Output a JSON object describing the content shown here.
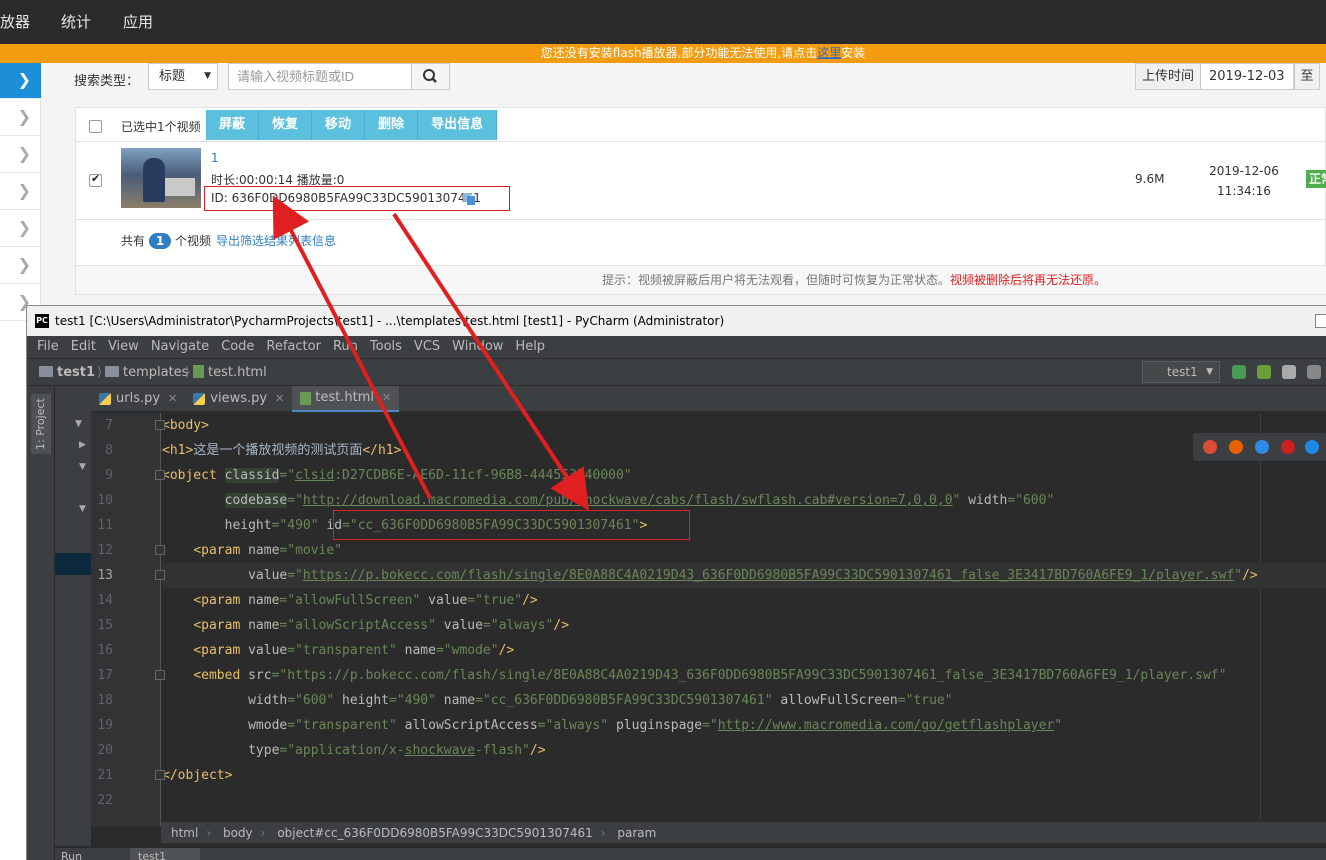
{
  "web": {
    "nav": [
      "放器",
      "统计",
      "应用"
    ],
    "flash_notice_prefix": "您还没有安装flash播放器,部分功能无法使用,请点击",
    "flash_notice_link": "这里",
    "flash_notice_suffix": "安装",
    "search": {
      "type_label": "搜索类型：",
      "type_value": "标题",
      "placeholder": "请输入视频标题或ID",
      "date_label": "上传时间",
      "date_from": "2019-12-03",
      "date_to_label": "至"
    },
    "toolbar": {
      "selected_text": "已选中1个视频",
      "buttons": [
        "屏蔽",
        "恢复",
        "移动",
        "删除",
        "导出信息"
      ]
    },
    "video": {
      "title": "1",
      "meta": "时长:00:00:14    播放量:0",
      "id_text": "ID: 636F0DD6980B5FA99C33DC5901307461",
      "size": "9.6M",
      "date": "2019-12-06",
      "time": "11:34:16",
      "status": "正常"
    },
    "footer": {
      "total_prefix": "共有",
      "total_count": "1",
      "total_suffix": "个视频",
      "export_link": "导出筛选结果列表信息"
    },
    "hint": "提示：视频被屏蔽后用户将无法观看，但随时可恢复为正常状态。",
    "hint_warn": "视频被删除后将再无法还原。"
  },
  "ide": {
    "title": "test1 [C:\\Users\\Administrator\\PycharmProjects\\test1] - ...\\templates\\test.html [test1] - PyCharm (Administrator)",
    "logo": "PC",
    "menu": [
      "File",
      "Edit",
      "View",
      "Navigate",
      "Code",
      "Refactor",
      "Run",
      "Tools",
      "VCS",
      "Window",
      "Help"
    ],
    "breadcrumb": [
      "test1",
      "templates",
      "test.html"
    ],
    "run_config": "test1",
    "project_tab": "1: Project",
    "tabs": [
      "urls.py",
      "views.py",
      "test.html"
    ],
    "line_numbers": [
      "7",
      "8",
      "9",
      "10",
      "11",
      "12",
      "13",
      "14",
      "15",
      "16",
      "17",
      "18",
      "19",
      "20",
      "21",
      "22"
    ],
    "status_path": [
      "html",
      "body",
      "object#cc_636F0DD6980B5FA99C33DC5901307461",
      "param"
    ],
    "bottom_tabs": [
      "Run",
      "test1"
    ]
  }
}
